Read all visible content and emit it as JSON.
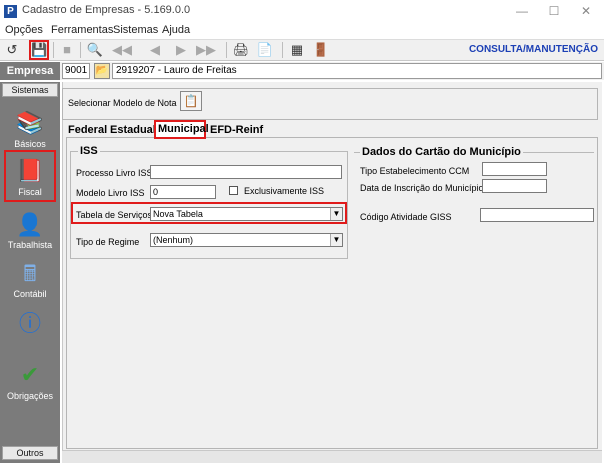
{
  "window": {
    "title": "Cadastro de Empresas - 5.169.0.0",
    "app_icon": "P"
  },
  "menu": [
    "Opções",
    "Ferramentas",
    "Sistemas",
    "Ajuda"
  ],
  "toolbar": {
    "mode_label": "CONSULTA/MANUTENÇÃO"
  },
  "empresa": {
    "label": "Empresa",
    "code": "9001",
    "name": "2919207 - Lauro de Freitas"
  },
  "sidebar": {
    "header": "Sistemas",
    "footer": "Outros",
    "items": [
      {
        "label": "Básicos",
        "icon": "books-icon"
      },
      {
        "label": "Fiscal",
        "icon": "fiscal-book-icon"
      },
      {
        "label": "Trabalhista",
        "icon": "worker-icon"
      },
      {
        "label": "Contábil",
        "icon": "calculator-icon"
      },
      {
        "label": "",
        "icon": "info-icon"
      },
      {
        "label": "Obrigações",
        "icon": "checklist-icon"
      }
    ]
  },
  "model": {
    "label": "Selecionar Modelo de Nota"
  },
  "tabs": [
    "Federal",
    "Estadual",
    "Municipal",
    "EFD-Reinf"
  ],
  "iss": {
    "title": "ISS",
    "processo_label": "Processo Livro ISS",
    "processo_value": "",
    "modelo_label": "Modelo Livro ISS",
    "modelo_value": "0",
    "exclusivo_label": "Exclusivamente ISS",
    "tabela_label": "Tabela de Serviços",
    "tabela_value": "Nova Tabela",
    "regime_label": "Tipo de Regime",
    "regime_value": "(Nenhum)"
  },
  "cartao": {
    "title": "Dados do Cartão do Município",
    "ccm_label": "Tipo Estabelecimento CCM",
    "inscricao_label": "Data de Inscrição do Município",
    "giss_label": "Código Atividade GISS"
  }
}
